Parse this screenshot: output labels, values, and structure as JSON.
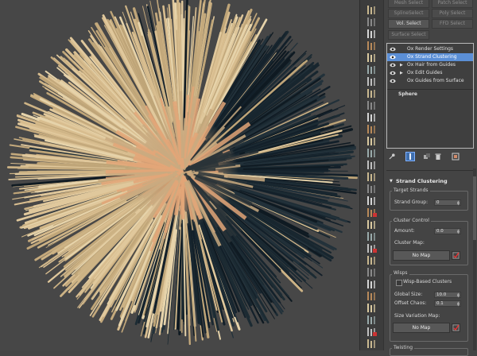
{
  "selection": {
    "mesh_select": "Mesh Select",
    "patch_select": "Patch Select",
    "spline_select": "SplineSelect",
    "poly_select": "Poly Select",
    "vol_select": "Vol. Select",
    "ffd_select": "FFD Select",
    "surface_select": "Surface Select"
  },
  "modifier_stack": [
    {
      "label": "Ox Render Settings",
      "expandable": false,
      "active": false
    },
    {
      "label": "Ox Strand Clustering",
      "expandable": false,
      "active": true
    },
    {
      "label": "Ox Hair from Guides",
      "expandable": true,
      "active": false
    },
    {
      "label": "Ox Edit Guides",
      "expandable": true,
      "active": false
    },
    {
      "label": "Ox Guides from Surface",
      "expandable": false,
      "active": false
    }
  ],
  "base_object": "Sphere",
  "rollout": {
    "title": "Strand Clustering",
    "toggle": "▼",
    "target_strands": {
      "title": "Target Strands",
      "strand_group_label": "Strand Group:",
      "strand_group_value": "0"
    },
    "cluster_control": {
      "title": "Cluster Control",
      "amount_label": "Amount:",
      "amount_value": "0.0",
      "cluster_map_label": "Cluster Map:",
      "cluster_map_button": "No Map"
    },
    "wisps": {
      "title": "Wisps",
      "wisp_based_label": "Wisp-Based Clusters",
      "wisp_based_checked": false,
      "global_size_label": "Global Size:",
      "global_size_value": "10.0",
      "offset_chaos_label": "Offset Chaos:",
      "offset_chaos_value": "0.1",
      "size_variation_label": "Size Variation Map:",
      "size_variation_button": "No Map"
    },
    "next_group": "Twisting"
  },
  "colors": {
    "active_modifier": "#5b8fd6",
    "hair_light": "#d9c29a",
    "hair_dark": "#13202a",
    "hair_root": "#d98b57",
    "viewport_bg": "#474747"
  },
  "icons": {
    "eye": "eye-icon",
    "pin": "pin-stack-icon",
    "show_end": "show-end-result-icon",
    "unique": "make-unique-icon",
    "remove": "remove-modifier-icon",
    "configure": "configure-modifier-sets-icon"
  }
}
